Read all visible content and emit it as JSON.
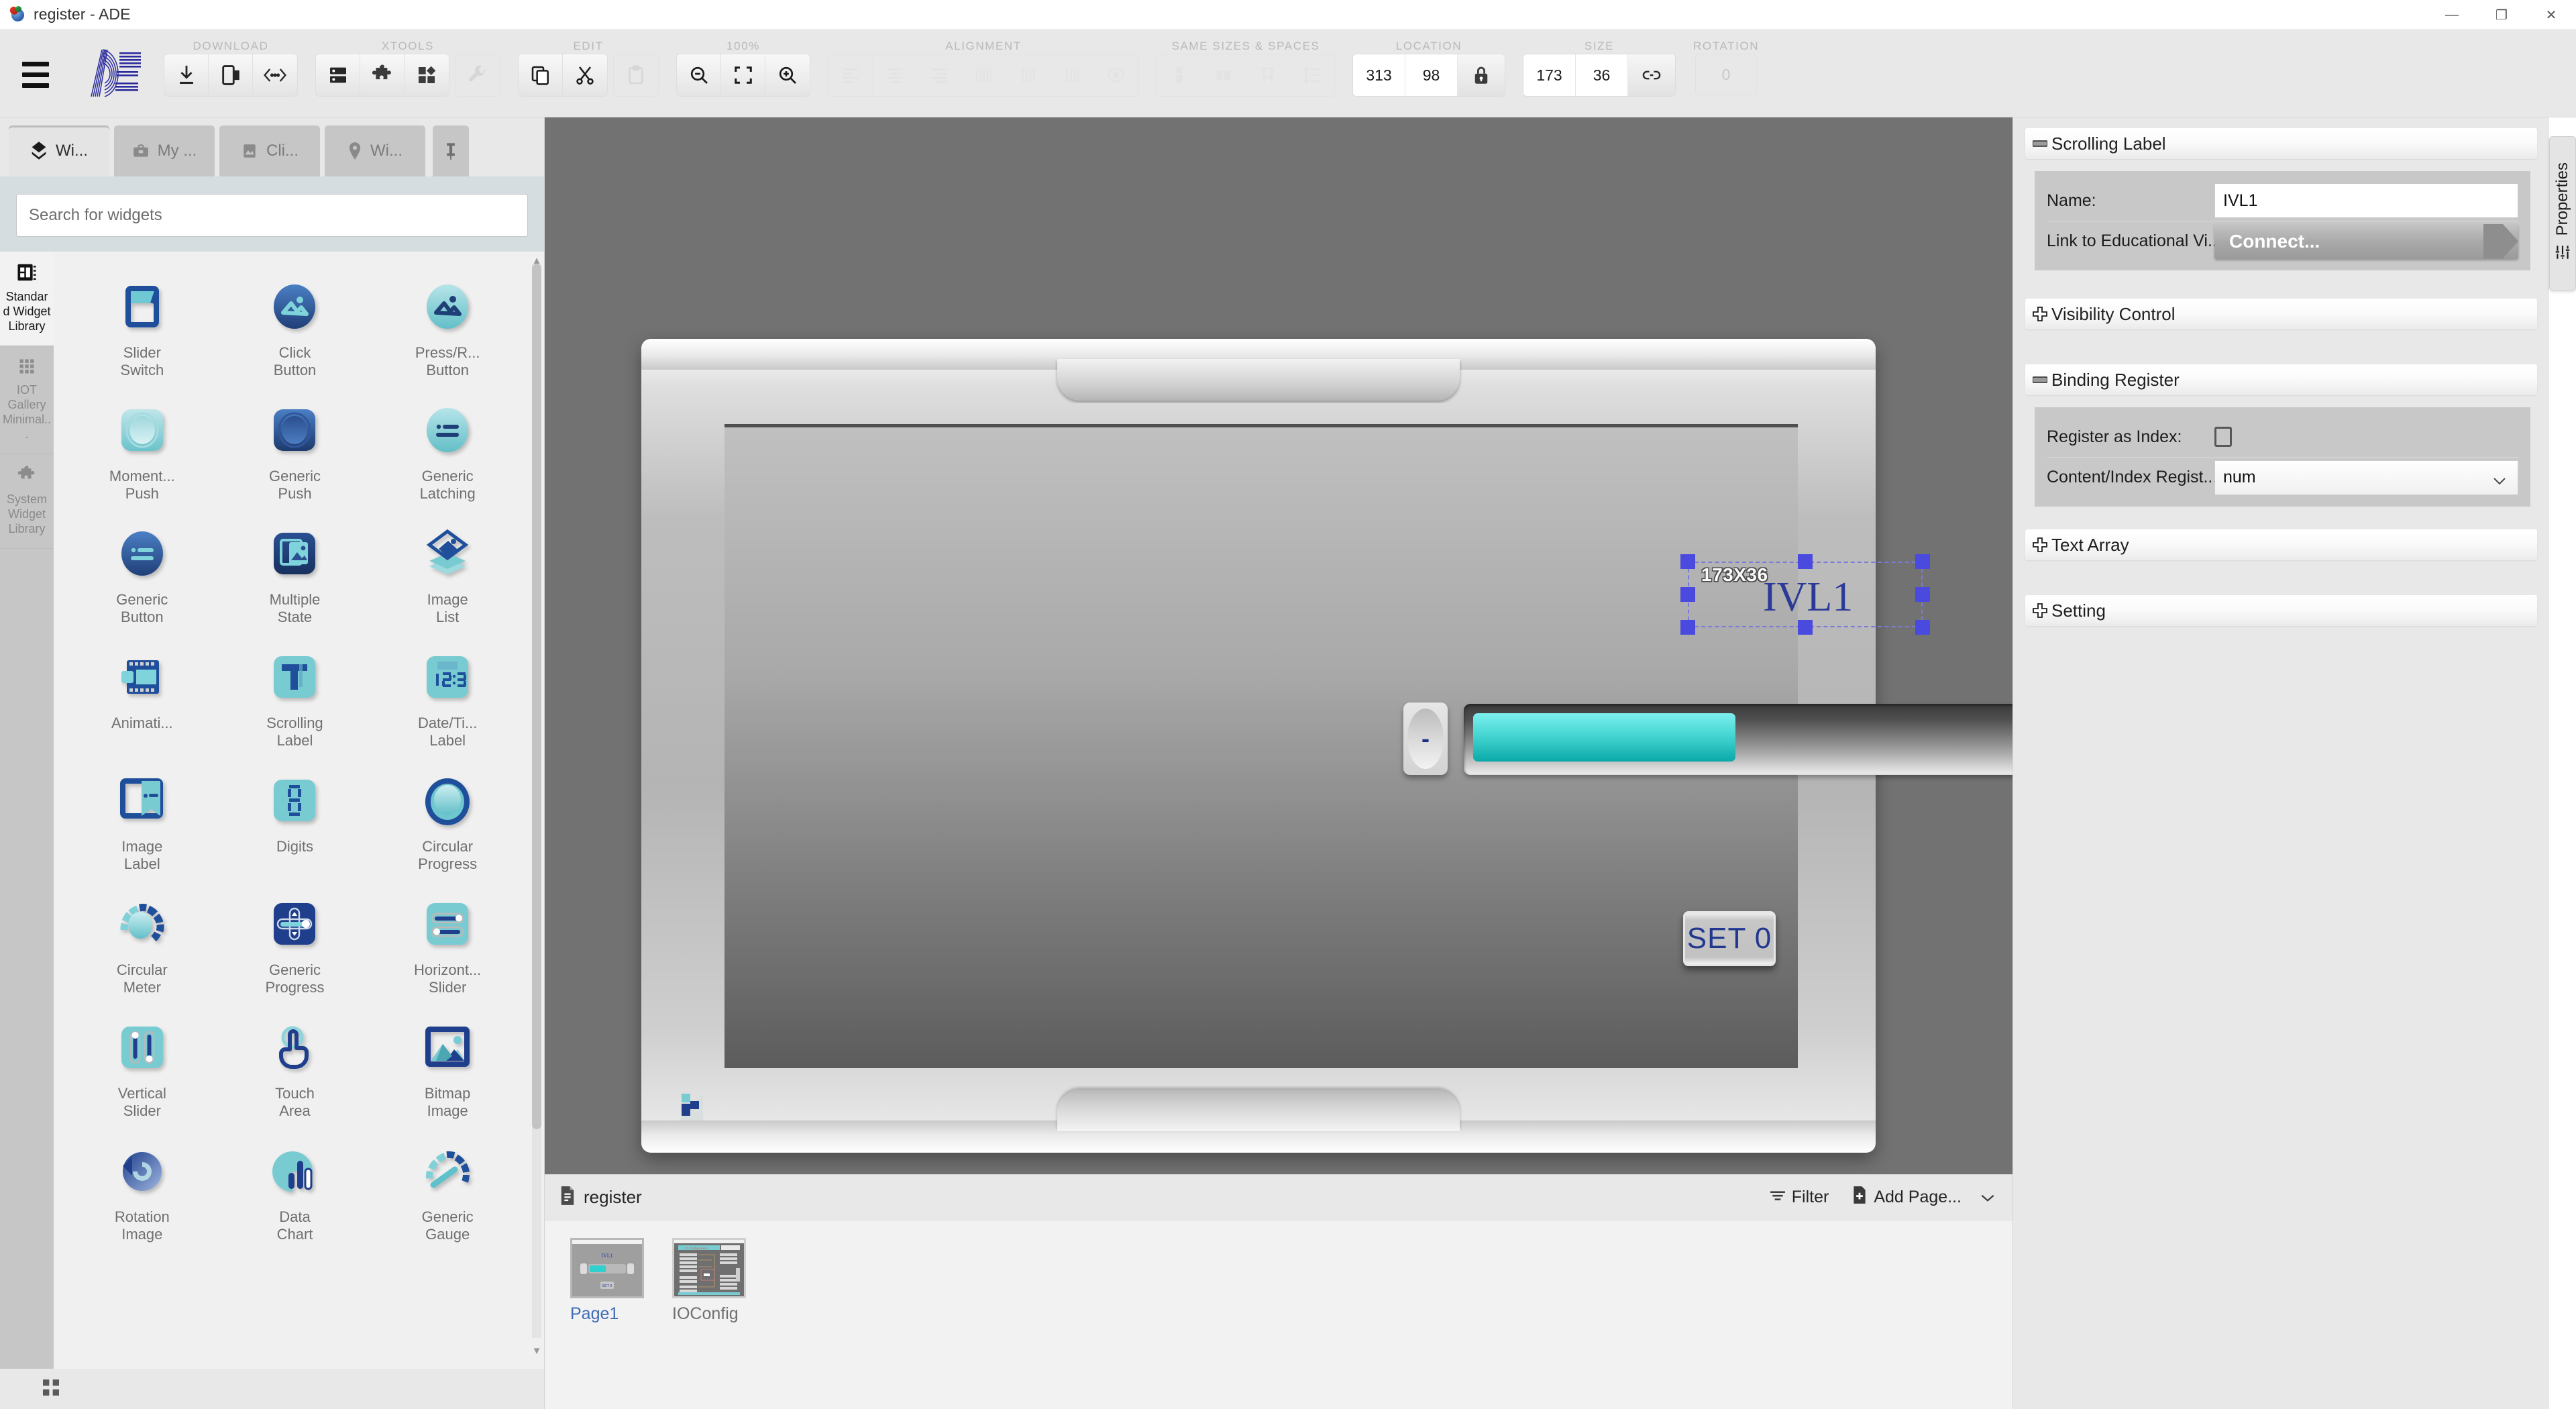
{
  "window": {
    "title": "register - ADE",
    "app_icon": "ade-app-icon",
    "controls": {
      "minimize": "—",
      "maximize": "❐",
      "close": "✕"
    }
  },
  "ribbon": {
    "menu_icon": "hamburger-menu-icon",
    "brand_logo": "ade-logo",
    "groups": [
      {
        "label": "DOWNLOAD",
        "buttons": [
          {
            "name": "download-icon",
            "enabled": true
          },
          {
            "name": "simulate-icon",
            "enabled": true
          },
          {
            "name": "code-brackets-icon",
            "enabled": true
          }
        ]
      },
      {
        "label": "XTOOLS",
        "buttons": [
          {
            "name": "database-icon",
            "enabled": true
          },
          {
            "name": "puzzle-icon",
            "enabled": true
          },
          {
            "name": "widgets-icon",
            "enabled": true
          },
          {
            "name": "wrench-icon",
            "enabled": false
          }
        ]
      },
      {
        "label": "EDIT",
        "buttons": [
          {
            "name": "copy-icon",
            "enabled": true
          },
          {
            "name": "cut-icon",
            "enabled": true
          },
          {
            "name": "paste-icon",
            "enabled": false
          }
        ]
      },
      {
        "label": "100%",
        "buttons": [
          {
            "name": "zoom-out-icon",
            "enabled": true
          },
          {
            "name": "fit-screen-icon",
            "enabled": true
          },
          {
            "name": "zoom-in-icon",
            "enabled": true
          }
        ]
      },
      {
        "label": "ALIGNMENT",
        "buttons": [
          {
            "name": "align-left-icon",
            "enabled": false
          },
          {
            "name": "align-center-icon",
            "enabled": false
          },
          {
            "name": "align-right-icon",
            "enabled": false
          },
          {
            "name": "align-top-icon",
            "enabled": false
          },
          {
            "name": "align-middle-icon",
            "enabled": false
          },
          {
            "name": "align-bottom-icon",
            "enabled": false
          },
          {
            "name": "align-center-page-icon",
            "enabled": false
          }
        ]
      },
      {
        "label": "SAME SIZES & SPACES",
        "buttons": [
          {
            "name": "same-height-icon",
            "enabled": false
          },
          {
            "name": "same-width-icon",
            "enabled": false
          },
          {
            "name": "distribute-horizontal-icon",
            "enabled": false
          },
          {
            "name": "distribute-vertical-icon",
            "enabled": false
          }
        ]
      }
    ],
    "location": {
      "label": "LOCATION",
      "x": "313",
      "y": "98",
      "lock_icon": "lock-icon"
    },
    "size": {
      "label": "SIZE",
      "w": "173",
      "h": "36",
      "link_icon": "link-icon"
    },
    "rotation": {
      "label": "ROTATION",
      "value": "0"
    }
  },
  "left_panel": {
    "tabs": [
      {
        "label": "Wi...",
        "icon": "widgets-diamond-icon",
        "active": true
      },
      {
        "label": "My ...",
        "icon": "briefcase-icon",
        "active": false
      },
      {
        "label": "Cli...",
        "icon": "image-icon",
        "active": false
      },
      {
        "label": "Wi...",
        "icon": "location-pin-icon",
        "active": false
      }
    ],
    "pin_icon": "pin-icon",
    "search": {
      "placeholder": "Search for widgets",
      "value": ""
    },
    "libraries": [
      {
        "label": "Standard Widget Library",
        "icon": "library-book-icon",
        "active": true
      },
      {
        "label": "IOT Gallery Minimal...",
        "icon": "grid-dots-icon",
        "active": false
      },
      {
        "label": "System Widget Library",
        "icon": "puzzle-icon",
        "active": false
      }
    ],
    "widgets": [
      {
        "name": "Slider\nSwitch",
        "icon": "slider-switch-icon"
      },
      {
        "name": "Click\nButton",
        "icon": "click-button-icon"
      },
      {
        "name": "Press/R...\nButton",
        "icon": "press-release-button-icon"
      },
      {
        "name": "Moment...\nPush",
        "icon": "momentary-push-icon"
      },
      {
        "name": "Generic\nPush",
        "icon": "generic-push-icon"
      },
      {
        "name": "Generic\nLatching",
        "icon": "generic-latching-icon"
      },
      {
        "name": "Generic\nButton",
        "icon": "generic-button-icon"
      },
      {
        "name": "Multiple\nState",
        "icon": "multiple-state-icon"
      },
      {
        "name": "Image\nList",
        "icon": "image-list-icon"
      },
      {
        "name": "Animati...",
        "icon": "animation-icon"
      },
      {
        "name": "Scrolling\nLabel",
        "icon": "scrolling-label-icon"
      },
      {
        "name": "Date/Ti...\nLabel",
        "icon": "date-time-label-icon"
      },
      {
        "name": "Image\nLabel",
        "icon": "image-label-icon"
      },
      {
        "name": "Digits",
        "icon": "digits-icon"
      },
      {
        "name": "Circular\nProgress",
        "icon": "circular-progress-icon"
      },
      {
        "name": "Circular\nMeter",
        "icon": "circular-meter-icon"
      },
      {
        "name": "Generic\nProgress",
        "icon": "generic-progress-icon"
      },
      {
        "name": "Horizont...\nSlider",
        "icon": "horizontal-slider-icon"
      },
      {
        "name": "Vertical\nSlider",
        "icon": "vertical-slider-icon"
      },
      {
        "name": "Touch\nArea",
        "icon": "touch-area-icon"
      },
      {
        "name": "Bitmap\nImage",
        "icon": "bitmap-image-icon"
      },
      {
        "name": "Rotation\nImage",
        "icon": "rotation-image-icon"
      },
      {
        "name": "Data\nChart",
        "icon": "data-chart-icon"
      },
      {
        "name": "Generic\nGauge",
        "icon": "generic-gauge-icon"
      }
    ],
    "grid_toggle_icon": "grid-view-icon"
  },
  "canvas": {
    "selection": {
      "size_tooltip": "173X36",
      "label_text": "IVL1"
    },
    "slider": {
      "minus_label": "-",
      "plus_label": "+",
      "fill_percent": 46
    },
    "set_button_label": "SET 0",
    "corner_logo": "device-corner-logo"
  },
  "page_panel": {
    "project_icon": "document-icon",
    "project_name": "register",
    "filter_label": "Filter",
    "filter_icon": "filter-icon",
    "add_page_label": "Add Page...",
    "add_page_icon": "add-page-icon",
    "chevron_icon": "chevron-down-icon",
    "pages": [
      {
        "name": "Page1",
        "selected": true
      },
      {
        "name": "IOConfig",
        "selected": false
      }
    ]
  },
  "properties": {
    "tab_label": "Properties",
    "tab_icon": "sliders-icon",
    "sections": [
      {
        "title": "Scrolling Label",
        "expanded": true,
        "toggle_icon": "minus-icon",
        "rows": [
          {
            "type": "text",
            "label": "Name:",
            "value": "IVL1"
          },
          {
            "type": "button",
            "label": "Link to Educational Vi...",
            "value": "Connect..."
          }
        ]
      },
      {
        "title": "Visibility Control",
        "expanded": false,
        "toggle_icon": "plus-icon",
        "rows": []
      },
      {
        "title": "Binding Register",
        "expanded": true,
        "toggle_icon": "minus-icon",
        "rows": [
          {
            "type": "checkbox",
            "label": "Register as Index:",
            "checked": false
          },
          {
            "type": "select",
            "label": "Content/Index Regist...",
            "value": "num"
          }
        ]
      },
      {
        "title": "Text Array",
        "expanded": false,
        "toggle_icon": "plus-icon",
        "rows": []
      },
      {
        "title": "Setting",
        "expanded": false,
        "toggle_icon": "plus-icon",
        "rows": []
      }
    ]
  }
}
